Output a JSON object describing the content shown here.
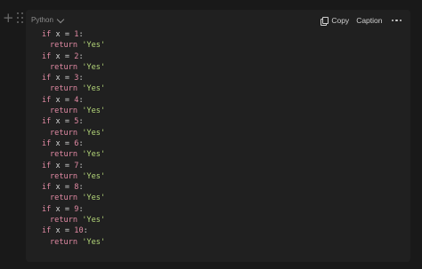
{
  "language_label": "Python",
  "toolbar": {
    "copy_label": "Copy",
    "caption_label": "Caption"
  },
  "code_lines": [
    "if x = 1:",
    "return 'Yes'",
    "if x = 2:",
    "return 'Yes'",
    "if x = 3:",
    "return 'Yes'",
    "if x = 4:",
    "return 'Yes'",
    "if x = 5:",
    "return 'Yes'",
    "if x = 6:",
    "return 'Yes'",
    "if x = 7:",
    "return 'Yes'",
    "if x = 8:",
    "return 'Yes'",
    "if x = 9:",
    "return 'Yes'",
    "if x = 10:",
    "return 'Yes'"
  ],
  "colors": {
    "background": "#191919",
    "code_background": "#202020",
    "keyword": "#e28aa4",
    "string": "#b6d97a"
  },
  "icons": [
    "plus-icon",
    "drag-handle-icon",
    "chevron-down-icon",
    "copy-icon",
    "more-icon"
  ]
}
